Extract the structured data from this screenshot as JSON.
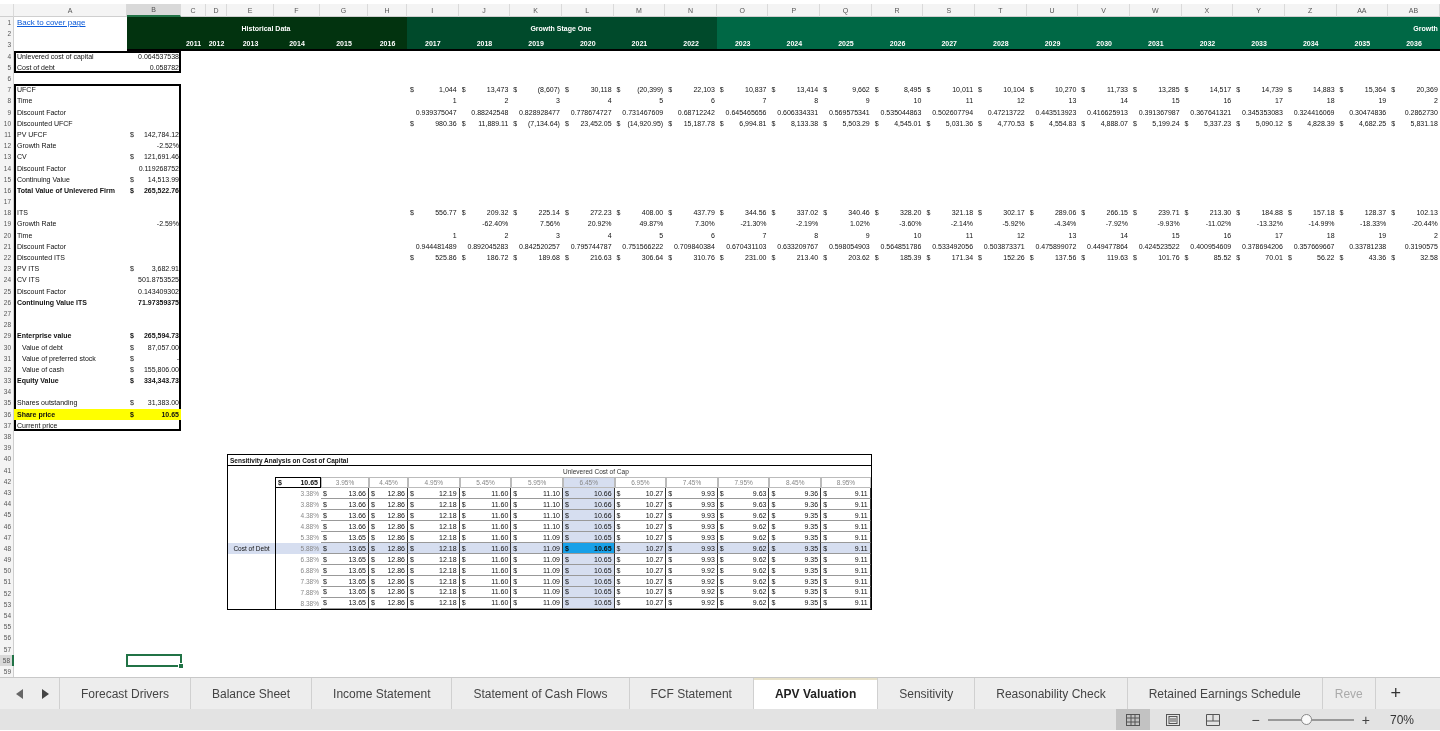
{
  "column_headers": [
    {
      "label": "A",
      "selected": false
    },
    {
      "label": "B",
      "selected": true
    },
    {
      "label": "C",
      "selected": false
    },
    {
      "label": "D",
      "selected": false
    },
    {
      "label": "E",
      "selected": false
    },
    {
      "label": "F",
      "selected": false
    },
    {
      "label": "G",
      "selected": false
    },
    {
      "label": "H",
      "selected": false
    },
    {
      "label": "I",
      "selected": false
    },
    {
      "label": "J",
      "selected": false
    },
    {
      "label": "K",
      "selected": false
    },
    {
      "label": "L",
      "selected": false
    },
    {
      "label": "M",
      "selected": false
    },
    {
      "label": "N",
      "selected": false
    },
    {
      "label": "O",
      "selected": false
    },
    {
      "label": "P",
      "selected": false
    },
    {
      "label": "Q",
      "selected": false
    },
    {
      "label": "R",
      "selected": false
    },
    {
      "label": "S",
      "selected": false
    },
    {
      "label": "T",
      "selected": false
    },
    {
      "label": "U",
      "selected": false
    },
    {
      "label": "V",
      "selected": false
    },
    {
      "label": "W",
      "selected": false
    },
    {
      "label": "X",
      "selected": false
    },
    {
      "label": "Y",
      "selected": false
    },
    {
      "label": "Z",
      "selected": false
    },
    {
      "label": "AA",
      "selected": false
    },
    {
      "label": "AB",
      "selected": false
    }
  ],
  "row_numbers": [
    {
      "label": "1",
      "selected": false
    },
    {
      "label": "2",
      "selected": false
    },
    {
      "label": "3",
      "selected": false
    },
    {
      "label": "4",
      "selected": false
    },
    {
      "label": "5",
      "selected": false
    },
    {
      "label": "6",
      "selected": false
    },
    {
      "label": "7",
      "selected": false
    },
    {
      "label": "8",
      "selected": false
    },
    {
      "label": "9",
      "selected": false
    },
    {
      "label": "10",
      "selected": false
    },
    {
      "label": "11",
      "selected": false
    },
    {
      "label": "12",
      "selected": false
    },
    {
      "label": "13",
      "selected": false
    },
    {
      "label": "14",
      "selected": false
    },
    {
      "label": "15",
      "selected": false
    },
    {
      "label": "16",
      "selected": false
    },
    {
      "label": "17",
      "selected": false
    },
    {
      "label": "18",
      "selected": false
    },
    {
      "label": "19",
      "selected": false
    },
    {
      "label": "20",
      "selected": false
    },
    {
      "label": "21",
      "selected": false
    },
    {
      "label": "22",
      "selected": false
    },
    {
      "label": "23",
      "selected": false
    },
    {
      "label": "24",
      "selected": false
    },
    {
      "label": "25",
      "selected": false
    },
    {
      "label": "26",
      "selected": false
    },
    {
      "label": "27",
      "selected": false
    },
    {
      "label": "28",
      "selected": false
    },
    {
      "label": "29",
      "selected": false
    },
    {
      "label": "30",
      "selected": false
    },
    {
      "label": "31",
      "selected": false
    },
    {
      "label": "32",
      "selected": false
    },
    {
      "label": "33",
      "selected": false
    },
    {
      "label": "34",
      "selected": false
    },
    {
      "label": "35",
      "selected": false
    },
    {
      "label": "36",
      "selected": false
    },
    {
      "label": "37",
      "selected": false
    },
    {
      "label": "38",
      "selected": false
    },
    {
      "label": "39",
      "selected": false
    },
    {
      "label": "40",
      "selected": false
    },
    {
      "label": "41",
      "selected": false
    },
    {
      "label": "42",
      "selected": false
    },
    {
      "label": "43",
      "selected": false
    },
    {
      "label": "44",
      "selected": false
    },
    {
      "label": "45",
      "selected": false
    },
    {
      "label": "46",
      "selected": false
    },
    {
      "label": "47",
      "selected": false
    },
    {
      "label": "48",
      "selected": false
    },
    {
      "label": "49",
      "selected": false
    },
    {
      "label": "50",
      "selected": false
    },
    {
      "label": "51",
      "selected": false
    },
    {
      "label": "52",
      "selected": false
    },
    {
      "label": "53",
      "selected": false
    },
    {
      "label": "54",
      "selected": false
    },
    {
      "label": "55",
      "selected": false
    },
    {
      "label": "56",
      "selected": false
    },
    {
      "label": "57",
      "selected": false
    },
    {
      "label": "58",
      "selected": true
    },
    {
      "label": "59",
      "selected": false
    }
  ],
  "link": "Back to cover page",
  "header_bands": [
    {
      "kind": "historical",
      "title": "Historical Data"
    },
    {
      "kind": "stage_one",
      "title": "Growth Stage One"
    },
    {
      "kind": "stage_two",
      "title": "Growth"
    }
  ],
  "years": [
    "2011",
    "2012",
    "2013",
    "2014",
    "2015",
    "2016",
    "2017",
    "2018",
    "2019",
    "2020",
    "2021",
    "2022",
    "2023",
    "2024",
    "2025",
    "2026",
    "2027",
    "2028",
    "2029",
    "2030",
    "2031",
    "2032",
    "2033",
    "2034",
    "2035",
    "2036"
  ],
  "inputs": [
    {
      "label": "Unlevered cost of capital",
      "value": "0.064537538"
    },
    {
      "label": "Cost of debt",
      "value": "0.058782"
    }
  ],
  "summary": [
    {
      "kind": "item",
      "label": "UFCF",
      "projection": [
        [
          "$",
          "1,044"
        ],
        [
          "$",
          "13,473"
        ],
        [
          "$",
          "(8,607)"
        ],
        [
          "$",
          "30,118"
        ],
        [
          "$",
          "(20,399)"
        ],
        [
          "$",
          "22,103"
        ],
        [
          "$",
          "10,837"
        ],
        [
          "$",
          "13,414"
        ],
        [
          "$",
          "9,662"
        ],
        [
          "$",
          "8,495"
        ],
        [
          "$",
          "10,011"
        ],
        [
          "$",
          "10,104"
        ],
        [
          "$",
          "10,270"
        ],
        [
          "$",
          "11,733"
        ],
        [
          "$",
          "13,285"
        ],
        [
          "$",
          "14,517"
        ],
        [
          "$",
          "14,739"
        ],
        [
          "$",
          "14,883"
        ],
        [
          "$",
          "15,364"
        ],
        [
          "$",
          "20,369"
        ]
      ]
    },
    {
      "kind": "item",
      "label": "Time",
      "projection": [
        "1",
        "2",
        "3",
        "4",
        "5",
        "6",
        "7",
        "8",
        "9",
        "10",
        "11",
        "12",
        "13",
        "14",
        "15",
        "16",
        "17",
        "18",
        "19",
        "2"
      ]
    },
    {
      "kind": "item",
      "label": "Discount Factor",
      "projection": [
        "0.939375047",
        "0.88242548",
        "0.828928477",
        "0.778674727",
        "0.731467609",
        "0.68712242",
        "0.645465656",
        "0.606334331",
        "0.569575341",
        "0.535044863",
        "0.502607794",
        "0.47213722",
        "0.443513923",
        "0.416625913",
        "0.391367987",
        "0.367641321",
        "0.345353083",
        "0.324416069",
        "0.30474836",
        "0.2862730"
      ]
    },
    {
      "kind": "item",
      "label": "Discounted UFCF",
      "projection": [
        [
          "$",
          "980.36"
        ],
        [
          "$",
          "11,889.11"
        ],
        [
          "$",
          "(7,134.64)"
        ],
        [
          "$",
          "23,452.05"
        ],
        [
          "$",
          "(14,920.95)"
        ],
        [
          "$",
          "15,187.78"
        ],
        [
          "$",
          "6,994.81"
        ],
        [
          "$",
          "8,133.38"
        ],
        [
          "$",
          "5,503.29"
        ],
        [
          "$",
          "4,545.01"
        ],
        [
          "$",
          "5,031.36"
        ],
        [
          "$",
          "4,770.53"
        ],
        [
          "$",
          "4,554.83"
        ],
        [
          "$",
          "4,888.07"
        ],
        [
          "$",
          "5,199.24"
        ],
        [
          "$",
          "5,337.23"
        ],
        [
          "$",
          "5,090.12"
        ],
        [
          "$",
          "4,828.39"
        ],
        [
          "$",
          "4,682.25"
        ],
        [
          "$",
          "5,831.18"
        ]
      ]
    },
    {
      "kind": "item",
      "label": "PV UFCF",
      "value": [
        "$",
        "142,784.12"
      ]
    },
    {
      "kind": "item",
      "label": "Growth Rate",
      "value": "-2.52%"
    },
    {
      "kind": "item",
      "label": "CV",
      "value": [
        "$",
        "121,691.46"
      ]
    },
    {
      "kind": "item",
      "label": "Discount Factor",
      "value": "0.119268752"
    },
    {
      "kind": "item",
      "label": "Continuing Value",
      "value": [
        "$",
        "14,513.99"
      ]
    },
    {
      "kind": "total",
      "label": "Total Value of Unlevered Firm",
      "value": [
        "$",
        "265,522.76"
      ]
    },
    {
      "kind": "blank"
    },
    {
      "kind": "item",
      "label": "ITS",
      "projection": [
        [
          "$",
          "556.77"
        ],
        [
          "$",
          "209.32"
        ],
        [
          "$",
          "225.14"
        ],
        [
          "$",
          "272.23"
        ],
        [
          "$",
          "408.00"
        ],
        [
          "$",
          "437.79"
        ],
        [
          "$",
          "344.56"
        ],
        [
          "$",
          "337.02"
        ],
        [
          "$",
          "340.46"
        ],
        [
          "$",
          "328.20"
        ],
        [
          "$",
          "321.18"
        ],
        [
          "$",
          "302.17"
        ],
        [
          "$",
          "289.06"
        ],
        [
          "$",
          "266.15"
        ],
        [
          "$",
          "239.71"
        ],
        [
          "$",
          "213.30"
        ],
        [
          "$",
          "184.88"
        ],
        [
          "$",
          "157.18"
        ],
        [
          "$",
          "128.37"
        ],
        [
          "$",
          "102.13"
        ]
      ]
    },
    {
      "kind": "item",
      "label": "Growth Rate",
      "value": "-2.59%",
      "projection": [
        "-62.40%",
        "7.56%",
        "20.92%",
        "49.87%",
        "7.30%",
        "-21.30%",
        "-2.19%",
        "1.02%",
        "-3.60%",
        "-2.14%",
        "-5.92%",
        "-4.34%",
        "-7.92%",
        "-9.93%",
        "-11.02%",
        "-13.32%",
        "-14.99%",
        "-18.33%",
        "-20.44%"
      ]
    },
    {
      "kind": "item",
      "label": "Time",
      "projection": [
        "1",
        "2",
        "3",
        "4",
        "5",
        "6",
        "7",
        "8",
        "9",
        "10",
        "11",
        "12",
        "13",
        "14",
        "15",
        "16",
        "17",
        "18",
        "19",
        "2"
      ]
    },
    {
      "kind": "item",
      "label": "Discount Factor",
      "projection": [
        "0.944481489",
        "0.892045283",
        "0.842520257",
        "0.795744787",
        "0.751566222",
        "0.709840384",
        "0.670431103",
        "0.633209767",
        "0.598054903",
        "0.564851786",
        "0.533492056",
        "0.503873371",
        "0.475899072",
        "0.449477864",
        "0.424523522",
        "0.400954609",
        "0.378694206",
        "0.357669667",
        "0.33781238",
        "0.3190575"
      ]
    },
    {
      "kind": "item",
      "label": "Discounted ITS",
      "projection": [
        [
          "$",
          "525.86"
        ],
        [
          "$",
          "186.72"
        ],
        [
          "$",
          "189.68"
        ],
        [
          "$",
          "216.63"
        ],
        [
          "$",
          "306.64"
        ],
        [
          "$",
          "310.76"
        ],
        [
          "$",
          "231.00"
        ],
        [
          "$",
          "213.40"
        ],
        [
          "$",
          "203.62"
        ],
        [
          "$",
          "185.39"
        ],
        [
          "$",
          "171.34"
        ],
        [
          "$",
          "152.26"
        ],
        [
          "$",
          "137.56"
        ],
        [
          "$",
          "119.63"
        ],
        [
          "$",
          "101.76"
        ],
        [
          "$",
          "85.52"
        ],
        [
          "$",
          "70.01"
        ],
        [
          "$",
          "56.22"
        ],
        [
          "$",
          "43.36"
        ],
        [
          "$",
          "32.58"
        ]
      ]
    },
    {
      "kind": "item",
      "label": "PV ITS",
      "value": [
        "$",
        "3,682.91"
      ]
    },
    {
      "kind": "item",
      "label": "CV ITS",
      "value": "501.8753525"
    },
    {
      "kind": "item",
      "label": "Discount Factor",
      "value": "0.143409302"
    },
    {
      "kind": "total",
      "label": "Continuing Value ITS",
      "value": "71.97359375"
    },
    {
      "kind": "blank"
    },
    {
      "kind": "blank"
    },
    {
      "kind": "total",
      "label": "Enterprise value",
      "value": [
        "$",
        "265,594.73"
      ]
    },
    {
      "kind": "sub",
      "label": "Value of debt",
      "value": [
        "$",
        "87,057.00"
      ]
    },
    {
      "kind": "sub",
      "label": "Value of preferred stock",
      "value": [
        "$",
        "-"
      ]
    },
    {
      "kind": "sub",
      "label": "Value of cash",
      "value": [
        "$",
        "155,806.00"
      ]
    },
    {
      "kind": "total",
      "label": "Equity Value",
      "value": [
        "$",
        "334,343.73"
      ]
    },
    {
      "kind": "blank"
    },
    {
      "kind": "item",
      "label": "Shares outstanding",
      "value": [
        "$",
        "31,383.00"
      ]
    },
    {
      "kind": "result",
      "label": "Share price",
      "value": [
        "$",
        "10.65"
      ]
    },
    {
      "kind": "item",
      "label": "Current price"
    }
  ],
  "sensitivity": {
    "title": "Sensitivity Analysis on Cost of Capital",
    "column_axis_label": "Unlevered Cost of Cap",
    "row_axis_label": "Cost of Debt",
    "corner": [
      "$",
      "10.65"
    ],
    "rate_headers": [
      {
        "label": "3.95%",
        "selected": false
      },
      {
        "label": "4.45%",
        "selected": false
      },
      {
        "label": "4.95%",
        "selected": false
      },
      {
        "label": "5.45%",
        "selected": false
      },
      {
        "label": "5.95%",
        "selected": false
      },
      {
        "label": "6.45%",
        "selected": true
      },
      {
        "label": "6.95%",
        "selected": false
      },
      {
        "label": "7.45%",
        "selected": false
      },
      {
        "label": "7.95%",
        "selected": false
      },
      {
        "label": "8.45%",
        "selected": false
      },
      {
        "label": "8.95%",
        "selected": false
      }
    ],
    "rows": [
      {
        "rate": "3.38%",
        "selected": false,
        "cells": [
          [
            "$",
            "13.66"
          ],
          [
            "$",
            "12.86"
          ],
          [
            "$",
            "12.19"
          ],
          [
            "$",
            "11.60"
          ],
          [
            "$",
            "11.10"
          ],
          [
            "$",
            "10.66"
          ],
          [
            "$",
            "10.27"
          ],
          [
            "$",
            "9.93"
          ],
          [
            "$",
            "9.63"
          ],
          [
            "$",
            "9.36"
          ],
          [
            "$",
            "9.11"
          ]
        ]
      },
      {
        "rate": "3.88%",
        "selected": false,
        "cells": [
          [
            "$",
            "13.66"
          ],
          [
            "$",
            "12.86"
          ],
          [
            "$",
            "12.18"
          ],
          [
            "$",
            "11.60"
          ],
          [
            "$",
            "11.10"
          ],
          [
            "$",
            "10.66"
          ],
          [
            "$",
            "10.27"
          ],
          [
            "$",
            "9.93"
          ],
          [
            "$",
            "9.63"
          ],
          [
            "$",
            "9.36"
          ],
          [
            "$",
            "9.11"
          ]
        ]
      },
      {
        "rate": "4.38%",
        "selected": false,
        "cells": [
          [
            "$",
            "13.66"
          ],
          [
            "$",
            "12.86"
          ],
          [
            "$",
            "12.18"
          ],
          [
            "$",
            "11.60"
          ],
          [
            "$",
            "11.10"
          ],
          [
            "$",
            "10.66"
          ],
          [
            "$",
            "10.27"
          ],
          [
            "$",
            "9.93"
          ],
          [
            "$",
            "9.62"
          ],
          [
            "$",
            "9.35"
          ],
          [
            "$",
            "9.11"
          ]
        ]
      },
      {
        "rate": "4.88%",
        "selected": false,
        "cells": [
          [
            "$",
            "13.66"
          ],
          [
            "$",
            "12.86"
          ],
          [
            "$",
            "12.18"
          ],
          [
            "$",
            "11.60"
          ],
          [
            "$",
            "11.10"
          ],
          [
            "$",
            "10.65"
          ],
          [
            "$",
            "10.27"
          ],
          [
            "$",
            "9.93"
          ],
          [
            "$",
            "9.62"
          ],
          [
            "$",
            "9.35"
          ],
          [
            "$",
            "9.11"
          ]
        ]
      },
      {
        "rate": "5.38%",
        "selected": false,
        "cells": [
          [
            "$",
            "13.65"
          ],
          [
            "$",
            "12.86"
          ],
          [
            "$",
            "12.18"
          ],
          [
            "$",
            "11.60"
          ],
          [
            "$",
            "11.09"
          ],
          [
            "$",
            "10.65"
          ],
          [
            "$",
            "10.27"
          ],
          [
            "$",
            "9.93"
          ],
          [
            "$",
            "9.62"
          ],
          [
            "$",
            "9.35"
          ],
          [
            "$",
            "9.11"
          ]
        ]
      },
      {
        "rate": "5.88%",
        "selected": true,
        "cells": [
          [
            "$",
            "13.65"
          ],
          [
            "$",
            "12.86"
          ],
          [
            "$",
            "12.18"
          ],
          [
            "$",
            "11.60"
          ],
          [
            "$",
            "11.09"
          ],
          [
            "$",
            "10.65"
          ],
          [
            "$",
            "10.27"
          ],
          [
            "$",
            "9.93"
          ],
          [
            "$",
            "9.62"
          ],
          [
            "$",
            "9.35"
          ],
          [
            "$",
            "9.11"
          ]
        ]
      },
      {
        "rate": "6.38%",
        "selected": false,
        "cells": [
          [
            "$",
            "13.65"
          ],
          [
            "$",
            "12.86"
          ],
          [
            "$",
            "12.18"
          ],
          [
            "$",
            "11.60"
          ],
          [
            "$",
            "11.09"
          ],
          [
            "$",
            "10.65"
          ],
          [
            "$",
            "10.27"
          ],
          [
            "$",
            "9.93"
          ],
          [
            "$",
            "9.62"
          ],
          [
            "$",
            "9.35"
          ],
          [
            "$",
            "9.11"
          ]
        ]
      },
      {
        "rate": "6.88%",
        "selected": false,
        "cells": [
          [
            "$",
            "13.65"
          ],
          [
            "$",
            "12.86"
          ],
          [
            "$",
            "12.18"
          ],
          [
            "$",
            "11.60"
          ],
          [
            "$",
            "11.09"
          ],
          [
            "$",
            "10.65"
          ],
          [
            "$",
            "10.27"
          ],
          [
            "$",
            "9.92"
          ],
          [
            "$",
            "9.62"
          ],
          [
            "$",
            "9.35"
          ],
          [
            "$",
            "9.11"
          ]
        ]
      },
      {
        "rate": "7.38%",
        "selected": false,
        "cells": [
          [
            "$",
            "13.65"
          ],
          [
            "$",
            "12.86"
          ],
          [
            "$",
            "12.18"
          ],
          [
            "$",
            "11.60"
          ],
          [
            "$",
            "11.09"
          ],
          [
            "$",
            "10.65"
          ],
          [
            "$",
            "10.27"
          ],
          [
            "$",
            "9.92"
          ],
          [
            "$",
            "9.62"
          ],
          [
            "$",
            "9.35"
          ],
          [
            "$",
            "9.11"
          ]
        ]
      },
      {
        "rate": "7.88%",
        "selected": false,
        "cells": [
          [
            "$",
            "13.65"
          ],
          [
            "$",
            "12.86"
          ],
          [
            "$",
            "12.18"
          ],
          [
            "$",
            "11.60"
          ],
          [
            "$",
            "11.09"
          ],
          [
            "$",
            "10.65"
          ],
          [
            "$",
            "10.27"
          ],
          [
            "$",
            "9.92"
          ],
          [
            "$",
            "9.62"
          ],
          [
            "$",
            "9.35"
          ],
          [
            "$",
            "9.11"
          ]
        ]
      },
      {
        "rate": "8.38%",
        "selected": false,
        "cells": [
          [
            "$",
            "13.65"
          ],
          [
            "$",
            "12.86"
          ],
          [
            "$",
            "12.18"
          ],
          [
            "$",
            "11.60"
          ],
          [
            "$",
            "11.09"
          ],
          [
            "$",
            "10.65"
          ],
          [
            "$",
            "10.27"
          ],
          [
            "$",
            "9.92"
          ],
          [
            "$",
            "9.62"
          ],
          [
            "$",
            "9.35"
          ],
          [
            "$",
            "9.11"
          ]
        ]
      }
    ]
  },
  "sheet_tabs": [
    {
      "label": "Forecast Drivers",
      "selected": false
    },
    {
      "label": "Balance Sheet",
      "selected": false
    },
    {
      "label": "Income Statement",
      "selected": false
    },
    {
      "label": "Statement of Cash Flows",
      "selected": false
    },
    {
      "label": "FCF Statement",
      "selected": false
    },
    {
      "label": "APV Valuation",
      "selected": true
    },
    {
      "label": "Sensitivity",
      "selected": false
    },
    {
      "label": "Reasonability Check",
      "selected": false
    },
    {
      "label": "Retained Earnings Schedule",
      "selected": false
    },
    {
      "label": "Reve",
      "selected": false
    }
  ],
  "add_sheet": "+",
  "view_buttons": [
    {
      "kind": "normal",
      "selected": true
    },
    {
      "kind": "page_layout",
      "selected": false
    },
    {
      "kind": "page_break",
      "selected": false
    }
  ],
  "zoom": {
    "minus": "−",
    "plus": "+",
    "level": 0.45,
    "reading": "70%"
  }
}
